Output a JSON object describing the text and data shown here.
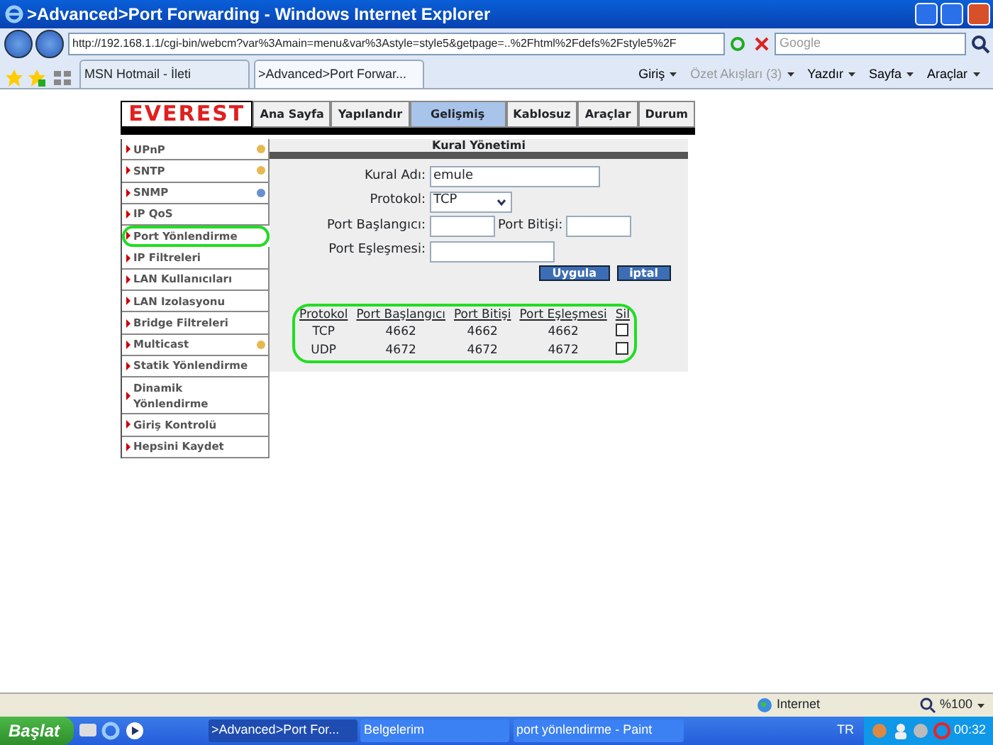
{
  "window": {
    "title": ">Advanced>Port Forwarding - Windows Internet Explorer"
  },
  "address_bar": {
    "url": "http://192.168.1.1/cgi-bin/webcm?var%3Amain=menu&var%3Astyle=style5&getpage=..%2Fhtml%2Fdefs%2Fstyle5%2F"
  },
  "search": {
    "placeholder": "Google"
  },
  "browser_tabs": [
    {
      "label": "MSN Hotmail - İleti",
      "selected": false
    },
    {
      "label": ">Advanced>Port Forwar...",
      "selected": true
    }
  ],
  "command_bar": [
    {
      "label": "Giriş",
      "disabled": false
    },
    {
      "label": "Özet Akışları (3)",
      "disabled": true
    },
    {
      "label": "Yazdır",
      "disabled": false
    },
    {
      "label": "Sayfa",
      "disabled": false
    },
    {
      "label": "Araçlar",
      "disabled": false
    }
  ],
  "router": {
    "logo": "EVEREST",
    "nav": [
      {
        "label": "Ana Sayfa",
        "selected": false
      },
      {
        "label": "Yapılandır",
        "selected": false
      },
      {
        "label": "Gelişmiş",
        "selected": true
      },
      {
        "label": "Kablosuz",
        "selected": false
      },
      {
        "label": "Araçlar",
        "selected": false
      },
      {
        "label": "Durum",
        "selected": false
      }
    ],
    "sidebar": [
      {
        "label": "UPnP",
        "circled": false,
        "color": "#e8b850"
      },
      {
        "label": "SNTP",
        "circled": false,
        "color": "#e8b850"
      },
      {
        "label": "SNMP",
        "circled": false,
        "color": "#6a8fd0"
      },
      {
        "label": "IP QoS",
        "circled": false
      },
      {
        "label": "Port Yönlendirme",
        "circled": true
      },
      {
        "label": "IP Filtreleri",
        "circled": false
      },
      {
        "label": "LAN Kullanıcıları",
        "circled": false
      },
      {
        "label": "LAN Izolasyonu",
        "circled": false
      },
      {
        "label": "Bridge Filtreleri",
        "circled": false
      },
      {
        "label": "Multicast",
        "circled": false,
        "color": "#e8b850"
      },
      {
        "label": "Statik Yönlendirme",
        "circled": false
      },
      {
        "label": "Dinamik Yönlendirme",
        "circled": false
      },
      {
        "label": "Giriş Kontrolü",
        "circled": false
      },
      {
        "label": "Hepsini Kaydet",
        "circled": false
      }
    ],
    "panel": {
      "title": "Kural Yönetimi",
      "rule_name": {
        "label": "Kural Adı:",
        "value": "emule"
      },
      "protocol": {
        "label": "Protokol:",
        "value": "TCP"
      },
      "port_start": {
        "label": "Port Başlangıcı:"
      },
      "port_end": {
        "label": "Port Bitişi:"
      },
      "port_map": {
        "label": "Port Eşleşmesi:"
      },
      "buttons": [
        "Uygula",
        "iptal"
      ],
      "table": {
        "circled": true,
        "columns": [
          "Protokol",
          "Port Başlangıcı",
          "Port Bitişi",
          "Port Eşleşmesi",
          "Sil"
        ],
        "rows": [
          {
            "cells": [
              "TCP",
              "4662",
              "4662",
              "4662"
            ],
            "checked": false
          },
          {
            "cells": [
              "UDP",
              "4672",
              "4672",
              "4672"
            ],
            "checked": false
          }
        ]
      }
    }
  },
  "status_bar": {
    "zone": "Internet",
    "zoom": "%100"
  },
  "taskbar": {
    "start": "Başlat",
    "tasks": [
      {
        "label": ">Advanced>Port For...",
        "selected": true
      },
      {
        "label": "Belgelerim",
        "selected": false
      },
      {
        "label": "port yönlendirme - Paint",
        "selected": false
      }
    ],
    "language": "TR",
    "clock": "00:32"
  }
}
